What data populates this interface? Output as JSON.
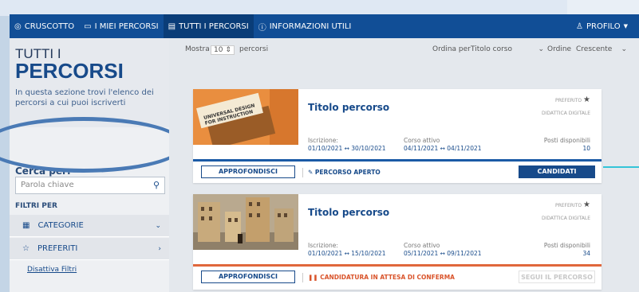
{
  "nav": {
    "items": [
      {
        "icon": "dashboard-icon",
        "label": "CRUSCOTTO"
      },
      {
        "icon": "monitor-icon",
        "label": "I MIEI PERCORSI"
      },
      {
        "icon": "list-icon",
        "label": "TUTTI I PERCORSI"
      },
      {
        "icon": "info-icon",
        "label": "INFORMAZIONI UTILI"
      }
    ],
    "profile": "PROFILO"
  },
  "sidebar": {
    "title_line1": "TUTTI I",
    "title_line2": "PERCORSI",
    "intro": "In questa sezione trovi l'elenco dei percorsi a cui puoi iscriverti",
    "search_title": "Cerca per:",
    "search_placeholder": "Parola chiave",
    "filters_title": "FILTRI PER",
    "categories": "CATEGORIE",
    "favorites": "PREFERITI",
    "disable_filters": "Disattiva Filtri"
  },
  "toolbar": {
    "show": "Mostra",
    "show_value": "10",
    "show_unit": "percorsi",
    "sort_by": "Ordina per",
    "sort_value": "Titolo corso",
    "order": "Ordine",
    "order_value": "Crescente"
  },
  "cards": [
    {
      "title": "Titolo percorso",
      "image_text_line1": "UNIVERSAL DESIGN",
      "image_text_line2": "FOR INSTRUCTION",
      "preferito": "PREFERITO",
      "tag": "DIDATTICA DIGITALE",
      "iscrizione_label": "Iscrizione:",
      "iscrizione_value": "01/10/2021 ↔ 30/10/2021",
      "corso_label": "Corso attivo",
      "corso_value": "04/11/2021 ↔ 04/11/2021",
      "posti_label": "Posti disponibili",
      "posti_value": "10",
      "status": "PERCORSO APERTO",
      "status_color": "#174a8a",
      "bar_color": "#1b5aa6",
      "approfondisci": "APPROFONDISCI",
      "action": "CANDIDATI"
    },
    {
      "title": "Titolo percorso",
      "preferito": "PREFERITO",
      "tag": "DIDATTICA DIGITALE",
      "iscrizione_label": "Iscrizione:",
      "iscrizione_value": "01/10/2021 ↔ 15/10/2021",
      "corso_label": "Corso attivo",
      "corso_value": "05/11/2021 ↔ 09/11/2021",
      "posti_label": "Posti disponibili",
      "posti_value": "34",
      "status": "CANDIDATURA IN ATTESA DI CONFERMA",
      "status_color": "#d9542b",
      "bar_color": "#e0673c",
      "approfondisci": "APPROFONDISCI",
      "action": "SEGUI IL PERCORSO"
    }
  ]
}
